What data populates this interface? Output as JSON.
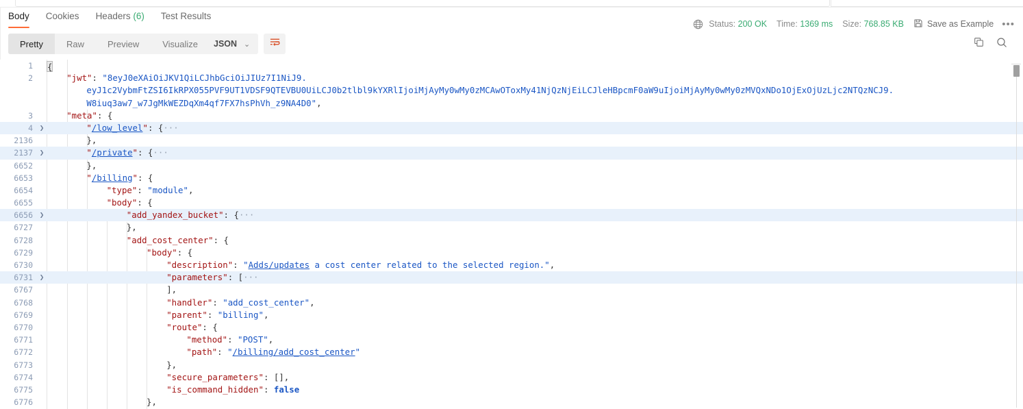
{
  "tabs": [
    {
      "label": "Body",
      "active": true
    },
    {
      "label": "Cookies",
      "active": false
    },
    {
      "label": "Headers ",
      "count": "(6)",
      "active": false
    },
    {
      "label": "Test Results",
      "active": false
    }
  ],
  "status_bar": {
    "globe_icon": "globe-icon",
    "status_label": "Status:",
    "status_value": "200 OK",
    "time_label": "Time:",
    "time_value": "1369 ms",
    "size_label": "Size:",
    "size_value": "768.85 KB",
    "save_icon": "save-floppy-icon",
    "save_label": "Save as Example",
    "more_label": "•••"
  },
  "controls": {
    "views": [
      {
        "label": "Pretty",
        "active": true
      },
      {
        "label": "Raw",
        "active": false
      },
      {
        "label": "Preview",
        "active": false
      },
      {
        "label": "Visualize",
        "active": false
      }
    ],
    "format": {
      "value": "JSON",
      "caret": "⌄"
    },
    "wrap_icon": "word-wrap-icon",
    "copy_icon": "copy-icon",
    "search_icon": "search-icon"
  },
  "colors": {
    "accent": "#ff6c37",
    "success": "#3aab72",
    "key": "#a31515",
    "string": "#1a56c4",
    "highlight_row": "#e8f1fb",
    "gutter_text": "#8b9bb4"
  },
  "code_lines": [
    {
      "num": "1",
      "fold": "",
      "indent": 0,
      "highlight": false,
      "parts": [
        {
          "t": "cursor",
          "v": "{"
        }
      ]
    },
    {
      "num": "2",
      "fold": "",
      "indent": 1,
      "highlight": false,
      "parts": [
        {
          "t": "k",
          "v": "\"jwt\""
        },
        {
          "t": "pun",
          "v": ": "
        },
        {
          "t": "str",
          "v": "\"8eyJ0eXAiOiJKV1QiLCJhbGciOiJIUz7I1NiJ9."
        }
      ]
    },
    {
      "num": "",
      "fold": "",
      "indent": 2,
      "highlight": false,
      "parts": [
        {
          "t": "str",
          "v": "eyJ1c2VybmFtZSI6IkRPX055PVF9UT1VDSF9QTEVBU0UiLCJ0b2tlbl9kYXRlIjoiMjAyMy0wMy0zMCAwOToxMy41NjQzNjEiLCJleHBpcmF0aW9uIjoiMjAyMy0wMy0zMVQxNDo1OjExOjUzLjc2NTQzNCJ9."
        }
      ]
    },
    {
      "num": "",
      "fold": "",
      "indent": 2,
      "highlight": false,
      "parts": [
        {
          "t": "str",
          "v": "W8iuq3aw7_w7JgMkWEZDqXm4qf7FX7hsPhVh_z9NA4D0\""
        },
        {
          "t": "pun",
          "v": ","
        }
      ]
    },
    {
      "num": "3",
      "fold": "",
      "indent": 1,
      "highlight": false,
      "parts": [
        {
          "t": "k",
          "v": "\"meta\""
        },
        {
          "t": "pun",
          "v": ": {"
        }
      ]
    },
    {
      "num": "4",
      "fold": "❯",
      "indent": 2,
      "highlight": true,
      "parts": [
        {
          "t": "k",
          "v": "\""
        },
        {
          "t": "klnk",
          "v": "/low_level"
        },
        {
          "t": "k",
          "v": "\""
        },
        {
          "t": "pun",
          "v": ": {"
        },
        {
          "t": "ell",
          "v": "···"
        }
      ]
    },
    {
      "num": "2136",
      "fold": "",
      "indent": 2,
      "highlight": false,
      "parts": [
        {
          "t": "pun",
          "v": "},"
        }
      ]
    },
    {
      "num": "2137",
      "fold": "❯",
      "indent": 2,
      "highlight": true,
      "parts": [
        {
          "t": "k",
          "v": "\""
        },
        {
          "t": "klnk",
          "v": "/private"
        },
        {
          "t": "k",
          "v": "\""
        },
        {
          "t": "pun",
          "v": ": {"
        },
        {
          "t": "ell",
          "v": "···"
        }
      ]
    },
    {
      "num": "6652",
      "fold": "",
      "indent": 2,
      "highlight": false,
      "parts": [
        {
          "t": "pun",
          "v": "},"
        }
      ]
    },
    {
      "num": "6653",
      "fold": "",
      "indent": 2,
      "highlight": false,
      "parts": [
        {
          "t": "k",
          "v": "\""
        },
        {
          "t": "klnk",
          "v": "/billing"
        },
        {
          "t": "k",
          "v": "\""
        },
        {
          "t": "pun",
          "v": ": {"
        }
      ]
    },
    {
      "num": "6654",
      "fold": "",
      "indent": 3,
      "highlight": false,
      "parts": [
        {
          "t": "k",
          "v": "\"type\""
        },
        {
          "t": "pun",
          "v": ": "
        },
        {
          "t": "str",
          "v": "\"module\""
        },
        {
          "t": "pun",
          "v": ","
        }
      ]
    },
    {
      "num": "6655",
      "fold": "",
      "indent": 3,
      "highlight": false,
      "parts": [
        {
          "t": "k",
          "v": "\"body\""
        },
        {
          "t": "pun",
          "v": ": {"
        }
      ]
    },
    {
      "num": "6656",
      "fold": "❯",
      "indent": 4,
      "highlight": true,
      "parts": [
        {
          "t": "k",
          "v": "\"add_yandex_bucket\""
        },
        {
          "t": "pun",
          "v": ": {"
        },
        {
          "t": "ell",
          "v": "···"
        }
      ]
    },
    {
      "num": "6727",
      "fold": "",
      "indent": 4,
      "highlight": false,
      "parts": [
        {
          "t": "pun",
          "v": "},"
        }
      ]
    },
    {
      "num": "6728",
      "fold": "",
      "indent": 4,
      "highlight": false,
      "parts": [
        {
          "t": "k",
          "v": "\"add_cost_center\""
        },
        {
          "t": "pun",
          "v": ": {"
        }
      ]
    },
    {
      "num": "6729",
      "fold": "",
      "indent": 5,
      "highlight": false,
      "parts": [
        {
          "t": "k",
          "v": "\"body\""
        },
        {
          "t": "pun",
          "v": ": {"
        }
      ]
    },
    {
      "num": "6730",
      "fold": "",
      "indent": 6,
      "highlight": false,
      "parts": [
        {
          "t": "k",
          "v": "\"description\""
        },
        {
          "t": "pun",
          "v": ": "
        },
        {
          "t": "str",
          "v": "\""
        },
        {
          "t": "lnk",
          "v": "Adds/updates"
        },
        {
          "t": "str",
          "v": " a cost center related to the selected region.\""
        },
        {
          "t": "pun",
          "v": ","
        }
      ]
    },
    {
      "num": "6731",
      "fold": "❯",
      "indent": 6,
      "highlight": true,
      "parts": [
        {
          "t": "k",
          "v": "\"parameters\""
        },
        {
          "t": "pun",
          "v": ": ["
        },
        {
          "t": "ell",
          "v": "···"
        }
      ]
    },
    {
      "num": "6767",
      "fold": "",
      "indent": 6,
      "highlight": false,
      "parts": [
        {
          "t": "pun",
          "v": "],"
        }
      ]
    },
    {
      "num": "6768",
      "fold": "",
      "indent": 6,
      "highlight": false,
      "parts": [
        {
          "t": "k",
          "v": "\"handler\""
        },
        {
          "t": "pun",
          "v": ": "
        },
        {
          "t": "str",
          "v": "\"add_cost_center\""
        },
        {
          "t": "pun",
          "v": ","
        }
      ]
    },
    {
      "num": "6769",
      "fold": "",
      "indent": 6,
      "highlight": false,
      "parts": [
        {
          "t": "k",
          "v": "\"parent\""
        },
        {
          "t": "pun",
          "v": ": "
        },
        {
          "t": "str",
          "v": "\"billing\""
        },
        {
          "t": "pun",
          "v": ","
        }
      ]
    },
    {
      "num": "6770",
      "fold": "",
      "indent": 6,
      "highlight": false,
      "parts": [
        {
          "t": "k",
          "v": "\"route\""
        },
        {
          "t": "pun",
          "v": ": {"
        }
      ]
    },
    {
      "num": "6771",
      "fold": "",
      "indent": 7,
      "highlight": false,
      "parts": [
        {
          "t": "k",
          "v": "\"method\""
        },
        {
          "t": "pun",
          "v": ": "
        },
        {
          "t": "str",
          "v": "\"POST\""
        },
        {
          "t": "pun",
          "v": ","
        }
      ]
    },
    {
      "num": "6772",
      "fold": "",
      "indent": 7,
      "highlight": false,
      "parts": [
        {
          "t": "k",
          "v": "\"path\""
        },
        {
          "t": "pun",
          "v": ": "
        },
        {
          "t": "str",
          "v": "\""
        },
        {
          "t": "lnk",
          "v": "/billing/add_cost_center"
        },
        {
          "t": "str",
          "v": "\""
        }
      ]
    },
    {
      "num": "6773",
      "fold": "",
      "indent": 6,
      "highlight": false,
      "parts": [
        {
          "t": "pun",
          "v": "},"
        }
      ]
    },
    {
      "num": "6774",
      "fold": "",
      "indent": 6,
      "highlight": false,
      "parts": [
        {
          "t": "k",
          "v": "\"secure_parameters\""
        },
        {
          "t": "pun",
          "v": ": [],"
        }
      ]
    },
    {
      "num": "6775",
      "fold": "",
      "indent": 6,
      "highlight": false,
      "parts": [
        {
          "t": "k",
          "v": "\"is_command_hidden\""
        },
        {
          "t": "pun",
          "v": ": "
        },
        {
          "t": "bool",
          "v": "false"
        }
      ]
    },
    {
      "num": "6776",
      "fold": "",
      "indent": 5,
      "highlight": false,
      "parts": [
        {
          "t": "pun",
          "v": "},"
        }
      ]
    }
  ]
}
